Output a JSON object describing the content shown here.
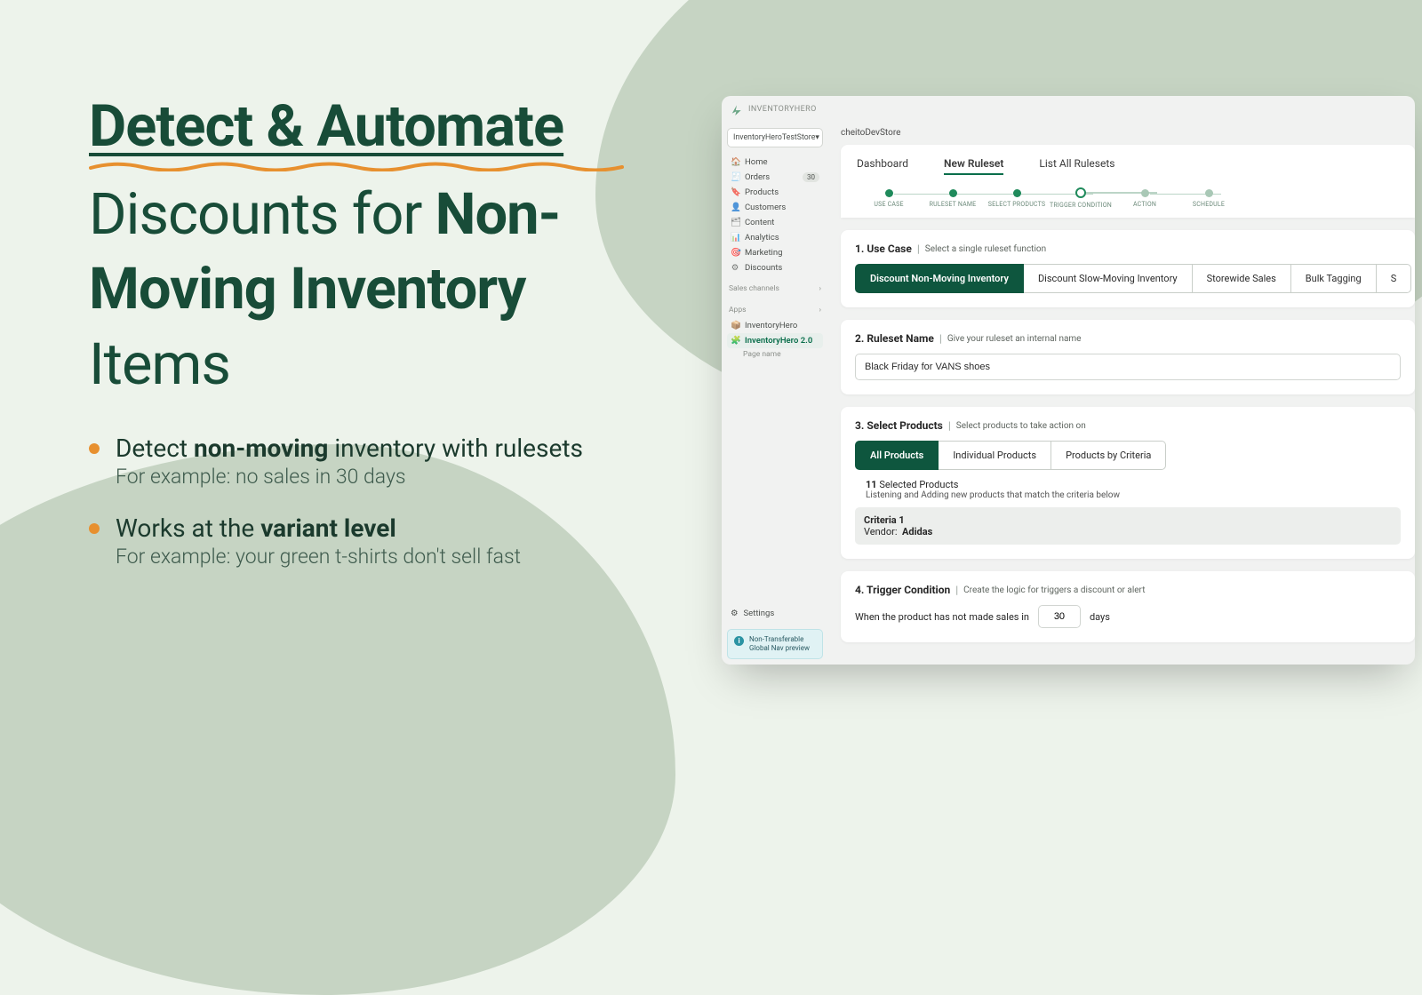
{
  "marketing": {
    "headline_underlined": "Detect & Automate",
    "headline_line2_light": "Discounts for ",
    "headline_line2_bold": "Non-Moving Inventory",
    "headline_line3_light": " Items",
    "bullets": [
      {
        "line1_pre": "Detect ",
        "line1_bold": "non-moving",
        "line1_post": " inventory with rulesets",
        "line2": "For example: no sales in 30 days"
      },
      {
        "line1_pre": "Works at the ",
        "line1_bold": "variant level",
        "line1_post": "",
        "line2": "For example: your green t-shirts don't sell fast"
      }
    ]
  },
  "brand": "INVENTORYHERO",
  "sidebar": {
    "store_select": "InventoryHeroTestStore",
    "nav": [
      {
        "icon": "🏠",
        "label": "Home"
      },
      {
        "icon": "🧾",
        "label": "Orders",
        "badge": "30"
      },
      {
        "icon": "🔖",
        "label": "Products"
      },
      {
        "icon": "👤",
        "label": "Customers"
      },
      {
        "icon": "🗂",
        "label": "Content"
      },
      {
        "icon": "📊",
        "label": "Analytics"
      },
      {
        "icon": "🎯",
        "label": "Marketing"
      },
      {
        "icon": "⚙",
        "label": "Discounts"
      }
    ],
    "sales_channels_label": "Sales channels",
    "apps_label": "Apps",
    "apps": [
      {
        "icon": "📦",
        "label": "InventoryHero",
        "active": false
      },
      {
        "icon": "🧩",
        "label": "InventoryHero 2.0",
        "active": true
      }
    ],
    "page_name": "Page name",
    "settings": "Settings",
    "info_line1": "Non-Transferable",
    "info_line2": "Global Nav preview"
  },
  "main": {
    "store_name": "cheitoDevStore",
    "tabs": [
      "Dashboard",
      "New Ruleset",
      "List All Rulesets"
    ],
    "active_tab": 1,
    "steps": [
      "USE CASE",
      "RULESET NAME",
      "SELECT PRODUCTS",
      "TRIGGER CONDITION",
      "ACTION",
      "SCHEDULE"
    ],
    "current_step": 3,
    "usecase": {
      "title": "1. Use Case",
      "hint": "Select a single ruleset function",
      "options": [
        "Discount Non-Moving Inventory",
        "Discount Slow-Moving Inventory",
        "Storewide Sales",
        "Bulk Tagging",
        "S"
      ],
      "active": 0
    },
    "ruleset_name": {
      "title": "2. Ruleset Name",
      "hint": "Give your ruleset an internal name",
      "value": "Black Friday for VANS shoes"
    },
    "select_products": {
      "title": "3. Select Products",
      "hint": "Select products to take action on",
      "options": [
        "All Products",
        "Individual Products",
        "Products by Criteria"
      ],
      "active": 0,
      "count": "11",
      "count_label": "Selected Products",
      "sub": "Listening and Adding new products that match the criteria below",
      "criteria_title": "Criteria 1",
      "criteria_key": "Vendor:",
      "criteria_val": "Adidas"
    },
    "trigger": {
      "title": "4. Trigger Condition",
      "hint": "Create the logic for triggers a discount or alert",
      "pre": "When the product has not made sales in",
      "value": "30",
      "post": "days"
    }
  }
}
